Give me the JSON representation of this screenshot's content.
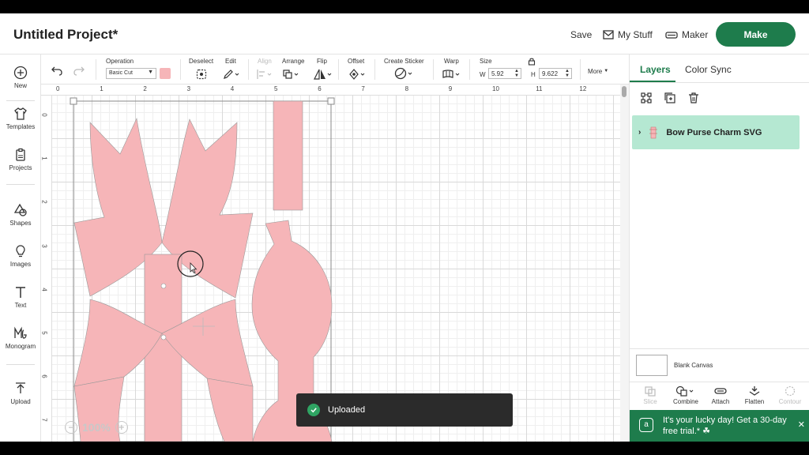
{
  "header": {
    "title": "Untitled Project*",
    "save_label": "Save",
    "mystuff_label": "My Stuff",
    "maker_label": "Maker",
    "make_label": "Make"
  },
  "sidebar": {
    "items": [
      {
        "label": "New",
        "icon": "plus-circle-icon"
      },
      {
        "label": "Templates",
        "icon": "shirt-icon"
      },
      {
        "label": "Projects",
        "icon": "clipboard-icon"
      },
      {
        "label": "Shapes",
        "icon": "shapes-icon"
      },
      {
        "label": "Images",
        "icon": "lightbulb-icon"
      },
      {
        "label": "Text",
        "icon": "text-icon"
      },
      {
        "label": "Monogram",
        "icon": "monogram-icon"
      },
      {
        "label": "Upload",
        "icon": "upload-icon"
      }
    ]
  },
  "toolbar": {
    "operation_label": "Operation",
    "operation_value": "Basic Cut",
    "operation_color": "#f6b5b8",
    "deselect_label": "Deselect",
    "edit_label": "Edit",
    "align_label": "Align",
    "arrange_label": "Arrange",
    "flip_label": "Flip",
    "offset_label": "Offset",
    "create_sticker_label": "Create Sticker",
    "warp_label": "Warp",
    "size_label": "Size",
    "width_label": "W",
    "width_value": "5.92",
    "height_label": "H",
    "height_value": "9.622",
    "more_label": "More"
  },
  "canvas": {
    "ruler_top": [
      "0",
      "1",
      "2",
      "3",
      "4",
      "5",
      "6",
      "7",
      "8",
      "9",
      "10",
      "11",
      "12"
    ],
    "ruler_left": [
      "0",
      "1",
      "2",
      "3",
      "4",
      "5",
      "6",
      "7"
    ],
    "zoom_level": "100%",
    "shape_fill": "#f6b5b8"
  },
  "toast": {
    "message": "Uploaded"
  },
  "right_panel": {
    "tabs": [
      "Layers",
      "Color Sync"
    ],
    "active_tab": "Layers",
    "layer_name": "Bow Purse Charm SVG",
    "blank_canvas_label": "Blank Canvas",
    "bottom_tools": [
      "Slice",
      "Combine",
      "Attach",
      "Flatten",
      "Contour"
    ],
    "promo_text": "It's your lucky day! Get a 30-day free trial.* ☘"
  }
}
